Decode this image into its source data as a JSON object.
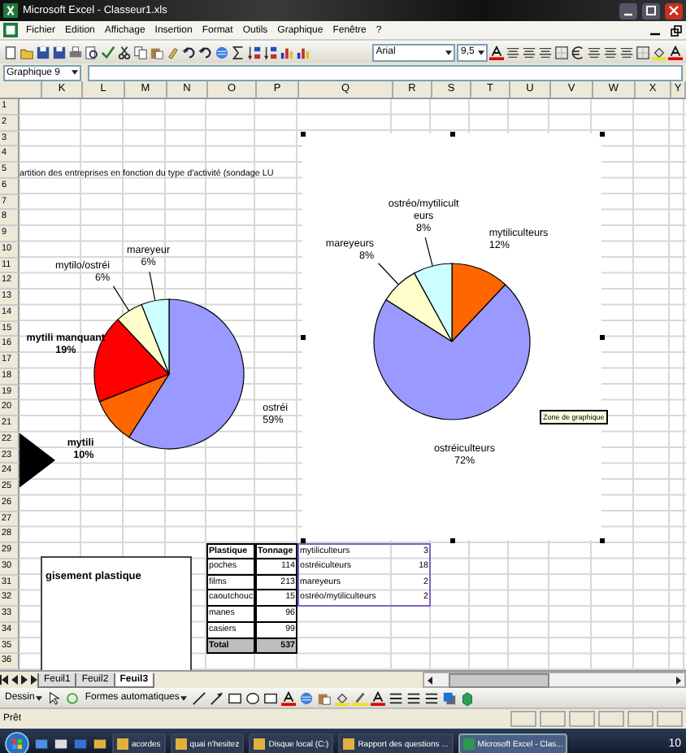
{
  "window": {
    "title": "Microsoft Excel - Classeur1.xls"
  },
  "menu": [
    "Fichier",
    "Edition",
    "Affichage",
    "Insertion",
    "Format",
    "Outils",
    "Graphique",
    "Fenêtre",
    "?"
  ],
  "toolbar": {
    "font": "Arial",
    "size": "9,5"
  },
  "name_box": "Graphique 9",
  "columns": [
    "K",
    "L",
    "M",
    "N",
    "O",
    "P",
    "Q",
    "R",
    "S",
    "T",
    "U",
    "V",
    "W",
    "X",
    "Y"
  ],
  "rows": [
    "1",
    "2",
    "3",
    "4",
    "5",
    "6",
    "7",
    "8",
    "9",
    "10",
    "11",
    "12",
    "13",
    "14",
    "15",
    "16",
    "17",
    "18",
    "19",
    "20",
    "21",
    "22",
    "23",
    "24",
    "25",
    "26",
    "27",
    "28",
    "29",
    "30",
    "31",
    "32",
    "33",
    "34",
    "35",
    "36"
  ],
  "charts": [
    {
      "selected": false,
      "area_fill": false,
      "slice_styles": [
        {
          "color": "#9999ff",
          "bold_label": false
        },
        {
          "color": "#ff6600",
          "bold_label": true
        },
        {
          "color": "#ff0000",
          "bold_label": true
        },
        {
          "color": "#ffffcc",
          "bold_label": false
        },
        {
          "color": "#ccffff",
          "bold_label": false
        }
      ],
      "chart_data": {
        "type": "pie",
        "title": "artition des entreprises en fonction du type d'activité (sondage LU",
        "categories": [
          "ostréi",
          "mytili",
          "mytili manquant",
          "mytilo/ostréi",
          "mareyeur"
        ],
        "values": [
          59,
          10,
          19,
          6,
          6
        ],
        "data_labels": true,
        "value_labels": [
          "59%",
          "10%",
          "19%",
          "6%",
          "6%"
        ]
      }
    },
    {
      "selected": true,
      "area_fill": true,
      "slice_styles": [
        {
          "color": "#ff6600",
          "bold_label": false
        },
        {
          "color": "#9999ff",
          "bold_label": false
        },
        {
          "color": "#ffffcc",
          "bold_label": false
        },
        {
          "color": "#ccffff",
          "bold_label": false
        }
      ],
      "chart_data": {
        "type": "pie",
        "categories": [
          "mytiliculteurs",
          "ostréiculteurs",
          "mareyeurs",
          "ostréo/mytiliculteurs"
        ],
        "values": [
          12,
          72,
          8,
          8
        ],
        "data_labels": true,
        "value_labels": [
          "12%",
          "72%",
          "8%",
          "8%"
        ]
      }
    }
  ],
  "tooltip": "Zone de graphique",
  "text_box": "gisement plastique",
  "plastic_table": {
    "columns": [
      "Plastique",
      "Tonnage"
    ],
    "rows": [
      [
        "poches",
        "114"
      ],
      [
        "films",
        "213"
      ],
      [
        "caoutchouc",
        "15"
      ],
      [
        "manes",
        "96"
      ],
      [
        "casiers",
        "99"
      ]
    ],
    "total": [
      "Total",
      "537"
    ]
  },
  "data_range": [
    [
      "mytiliculteurs",
      "3"
    ],
    [
      "ostréiculteurs",
      "18"
    ],
    [
      "mareyeurs",
      "2"
    ],
    [
      "ostréo/mytiliculteurs",
      "2"
    ]
  ],
  "sheets": [
    {
      "label": "Feuil1",
      "selected": false
    },
    {
      "label": "Feuil2",
      "selected": false
    },
    {
      "label": "Feuil3",
      "selected": true
    }
  ],
  "drawing_toolbar": {
    "draw_menu": "Dessin",
    "autoshapes": "Formes automatiques"
  },
  "status_bar": "Prêt",
  "taskbar": {
    "tasks": [
      {
        "label": "acordes",
        "selected": false
      },
      {
        "label": "quai n'hesitez",
        "selected": false
      },
      {
        "label": "Disque local (C:)",
        "selected": false
      },
      {
        "label": "Rapport des questions ...",
        "selected": false
      },
      {
        "label": "Microsoft Excel - Clas...",
        "selected": true
      }
    ],
    "clock": "10"
  }
}
